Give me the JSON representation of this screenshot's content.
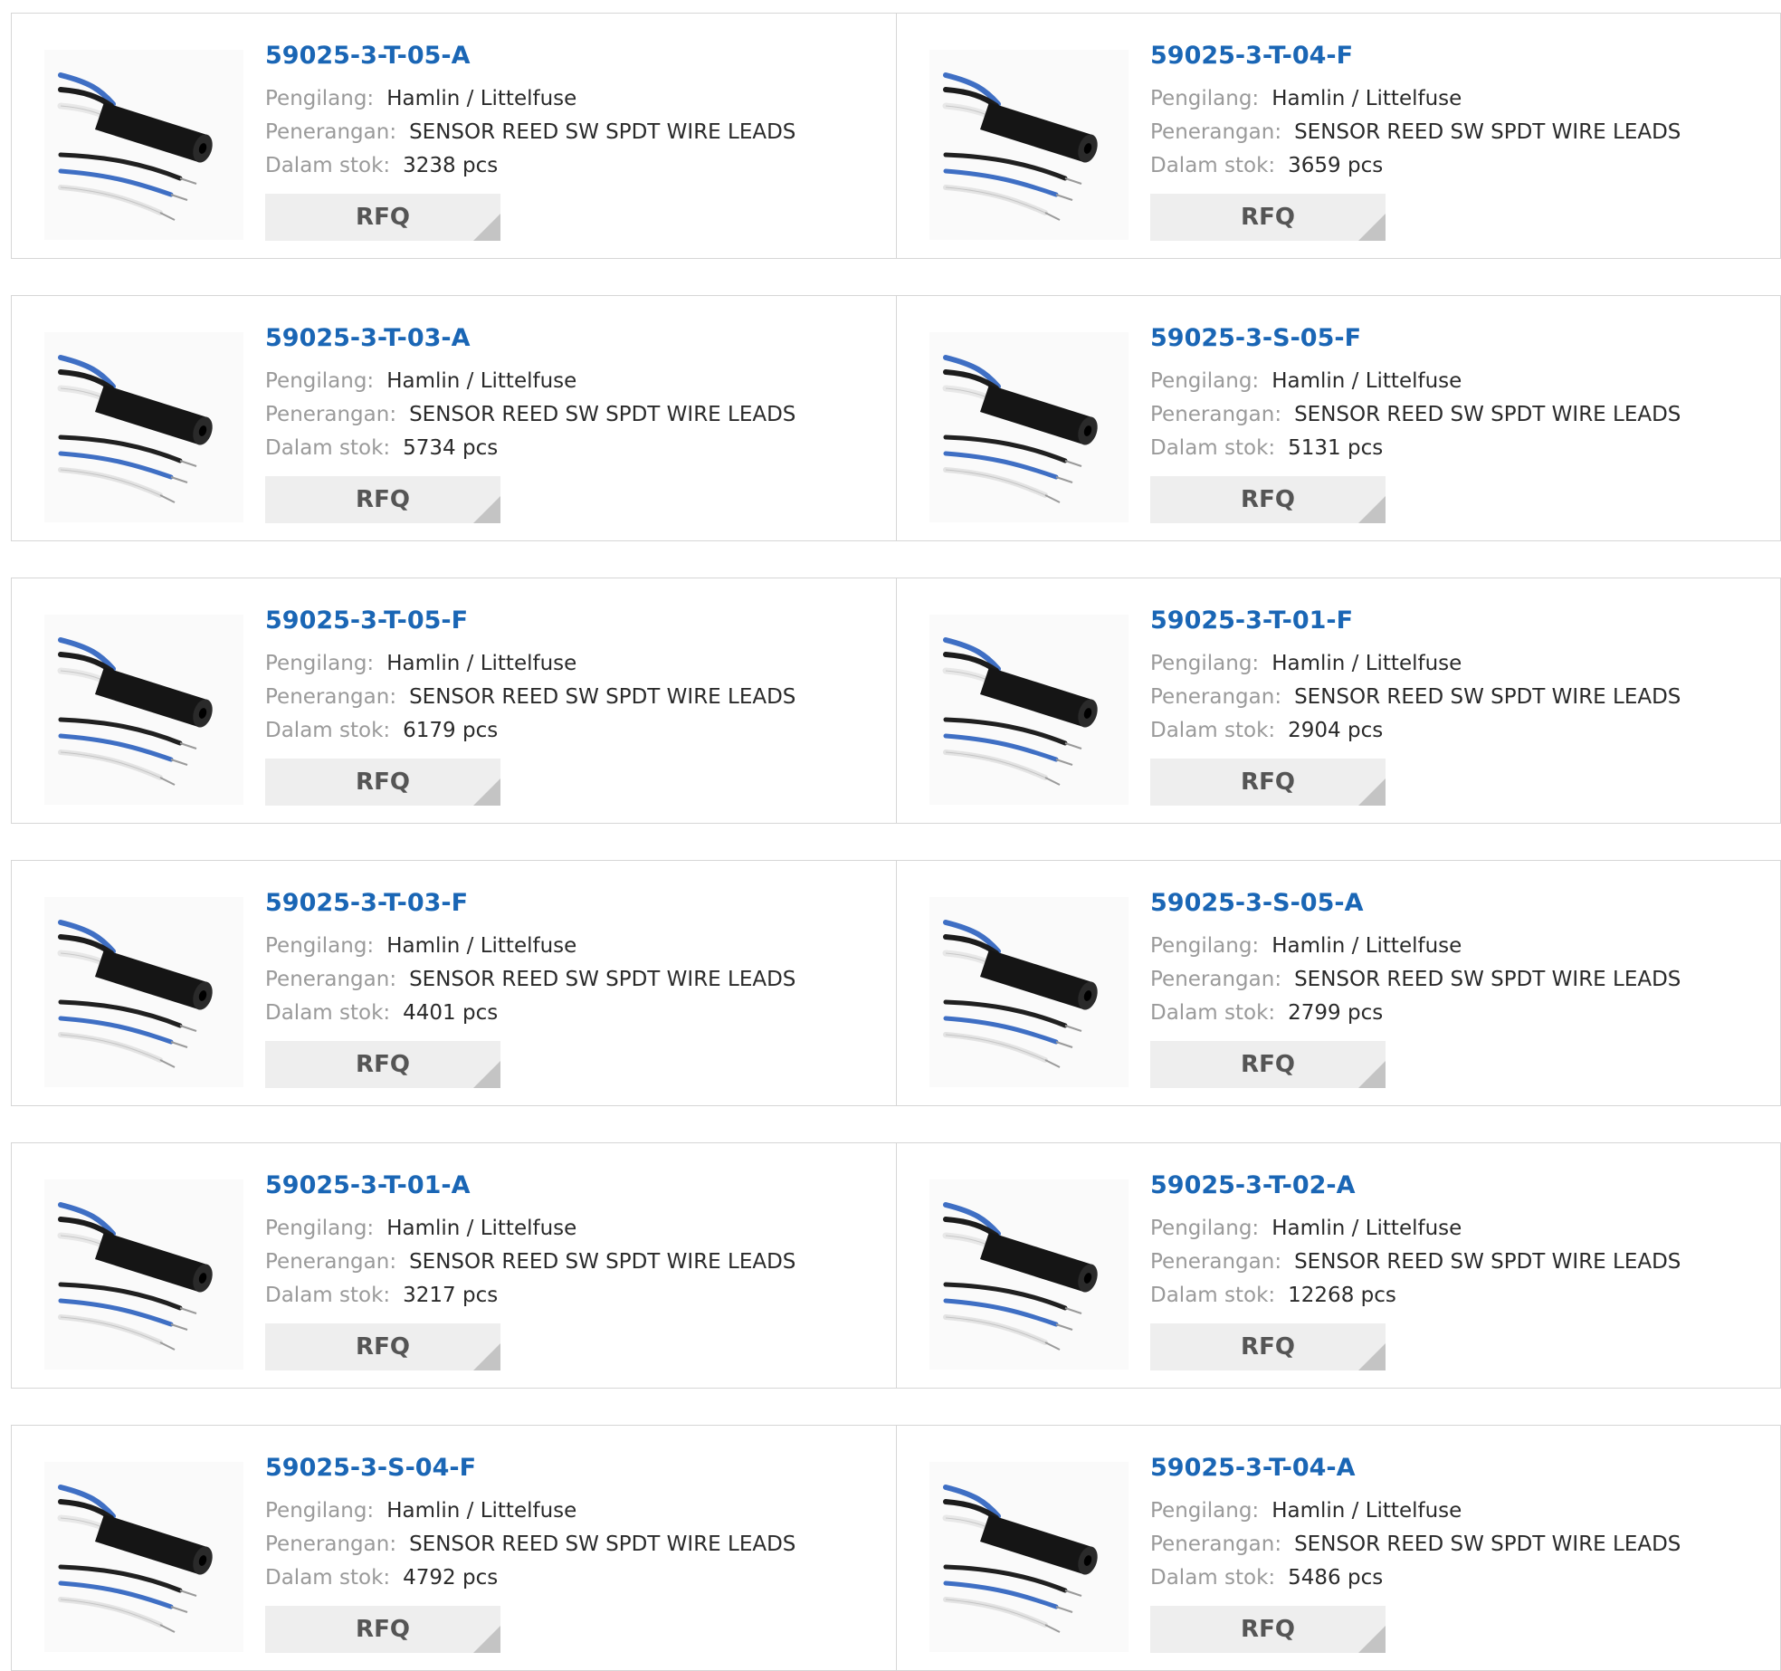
{
  "labels": {
    "manufacturer": "Pengilang:",
    "description": "Penerangan:",
    "stock": "Dalam stok:",
    "rfq": "RFQ"
  },
  "colors": {
    "part_link": "#1a66b5",
    "button_bg": "#eeeeee",
    "border": "#d6d6d6"
  },
  "image_icon": "reed-sensor-wire-leads-image",
  "products": [
    {
      "part": "59025-3-T-05-A",
      "manufacturer": "Hamlin / Littelfuse",
      "description": "SENSOR REED SW SPDT WIRE LEADS",
      "stock": "3238 pcs"
    },
    {
      "part": "59025-3-T-04-F",
      "manufacturer": "Hamlin / Littelfuse",
      "description": "SENSOR REED SW SPDT WIRE LEADS",
      "stock": "3659 pcs"
    },
    {
      "part": "59025-3-T-03-A",
      "manufacturer": "Hamlin / Littelfuse",
      "description": "SENSOR REED SW SPDT WIRE LEADS",
      "stock": "5734 pcs"
    },
    {
      "part": "59025-3-S-05-F",
      "manufacturer": "Hamlin / Littelfuse",
      "description": "SENSOR REED SW SPDT WIRE LEADS",
      "stock": "5131 pcs"
    },
    {
      "part": "59025-3-T-05-F",
      "manufacturer": "Hamlin / Littelfuse",
      "description": "SENSOR REED SW SPDT WIRE LEADS",
      "stock": "6179 pcs"
    },
    {
      "part": "59025-3-T-01-F",
      "manufacturer": "Hamlin / Littelfuse",
      "description": "SENSOR REED SW SPDT WIRE LEADS",
      "stock": "2904 pcs"
    },
    {
      "part": "59025-3-T-03-F",
      "manufacturer": "Hamlin / Littelfuse",
      "description": "SENSOR REED SW SPDT WIRE LEADS",
      "stock": "4401 pcs"
    },
    {
      "part": "59025-3-S-05-A",
      "manufacturer": "Hamlin / Littelfuse",
      "description": "SENSOR REED SW SPDT WIRE LEADS",
      "stock": "2799 pcs"
    },
    {
      "part": "59025-3-T-01-A",
      "manufacturer": "Hamlin / Littelfuse",
      "description": "SENSOR REED SW SPDT WIRE LEADS",
      "stock": "3217 pcs"
    },
    {
      "part": "59025-3-T-02-A",
      "manufacturer": "Hamlin / Littelfuse",
      "description": "SENSOR REED SW SPDT WIRE LEADS",
      "stock": "12268 pcs"
    },
    {
      "part": "59025-3-S-04-F",
      "manufacturer": "Hamlin / Littelfuse",
      "description": "SENSOR REED SW SPDT WIRE LEADS",
      "stock": "4792 pcs"
    },
    {
      "part": "59025-3-T-04-A",
      "manufacturer": "Hamlin / Littelfuse",
      "description": "SENSOR REED SW SPDT WIRE LEADS",
      "stock": "5486 pcs"
    }
  ]
}
